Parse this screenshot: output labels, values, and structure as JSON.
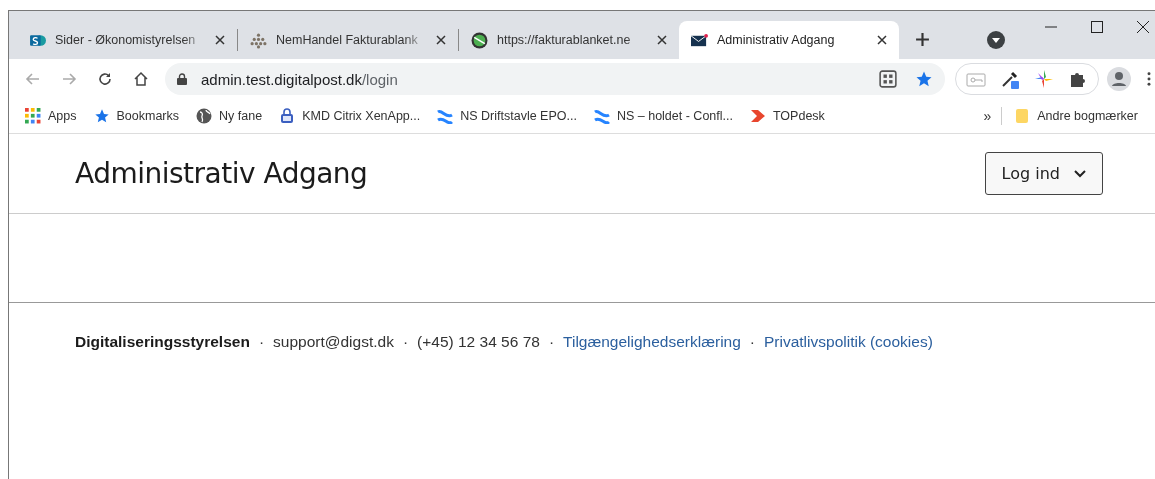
{
  "tabs": [
    {
      "title": "Sider - Økonomistyrelsen",
      "selected": false
    },
    {
      "title": "NemHandel Fakturablank",
      "selected": false
    },
    {
      "title": "https://fakturablanket.ne",
      "selected": false
    },
    {
      "title": "Administrativ Adgang",
      "selected": true
    }
  ],
  "address": {
    "host": "admin.test.digitalpost.dk",
    "path": "/login"
  },
  "bookmarks": [
    {
      "label": "Apps"
    },
    {
      "label": "Bookmarks"
    },
    {
      "label": "Ny fane"
    },
    {
      "label": "KMD Citrix XenApp..."
    },
    {
      "label": "NS Driftstavle EPO..."
    },
    {
      "label": "NS – holdet - Confl..."
    },
    {
      "label": "TOPdesk"
    }
  ],
  "bookmarks_overflow": "»",
  "other_bookmarks": "Andre bogmærker",
  "page": {
    "title": "Administrativ Adgang",
    "login_button": "Log ind"
  },
  "footer": [
    {
      "kind": "org",
      "text": "Digitaliseringsstyrelsen"
    },
    {
      "kind": "separator",
      "text": "·"
    },
    {
      "kind": "text",
      "text": "support@digst.dk"
    },
    {
      "kind": "separator",
      "text": "·"
    },
    {
      "kind": "text",
      "text": "(+45) 12 34 56 78"
    },
    {
      "kind": "separator",
      "text": "·"
    },
    {
      "kind": "link",
      "text": "Tilgængelighedserklæring"
    },
    {
      "kind": "separator",
      "text": "·"
    },
    {
      "kind": "link",
      "text": "Privatlivspolitik (cookies)"
    }
  ]
}
